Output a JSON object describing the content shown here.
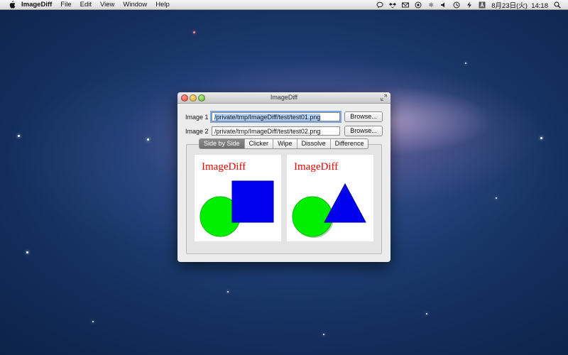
{
  "menubar": {
    "app_name": "ImageDiff",
    "items": [
      "File",
      "Edit",
      "View",
      "Window",
      "Help"
    ],
    "clock": "8月23日(火)  14:18"
  },
  "window": {
    "title": "ImageDiff",
    "image1": {
      "label": "Image 1",
      "value": "/private/tmp/ImageDiff/test/test01.png",
      "button": "Browse..."
    },
    "image2": {
      "label": "Image 2",
      "value": "/private/tmp/ImageDiff/test/test02.png",
      "button": "Browse..."
    },
    "tabs": [
      {
        "label": "Side by Side",
        "active": true
      },
      {
        "label": "Clicker",
        "active": false
      },
      {
        "label": "Wipe",
        "active": false
      },
      {
        "label": "Dissolve",
        "active": false
      },
      {
        "label": "Difference",
        "active": false
      }
    ],
    "left_image": {
      "title": "ImageDiff",
      "shapes": [
        "green-circle",
        "blue-square"
      ]
    },
    "right_image": {
      "title": "ImageDiff",
      "shapes": [
        "green-circle",
        "blue-triangle"
      ]
    }
  },
  "colors": {
    "shape_green": "#00ee00",
    "shape_blue": "#0000ee",
    "title_red": "#ee0000",
    "tab_active": "#7a7a7a"
  },
  "icons": [
    "apple-icon",
    "chat-icon",
    "dropbox-icon",
    "mail-icon",
    "sync-icon",
    "bluetooth-icon",
    "volume-icon",
    "time-machine-icon",
    "power-icon",
    "input-icon",
    "spotlight-icon"
  ]
}
